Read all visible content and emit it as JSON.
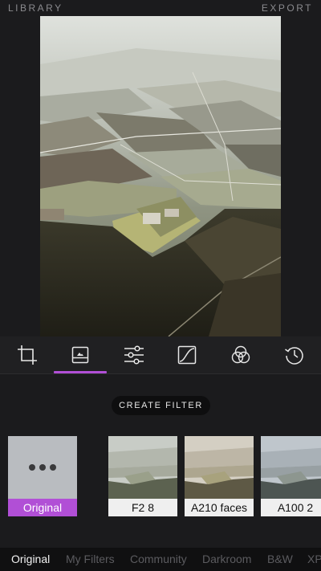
{
  "header": {
    "left": "LIBRARY",
    "right": "EXPORT"
  },
  "tools": [
    {
      "icon": "crop-icon"
    },
    {
      "icon": "filter-image-icon",
      "active": true
    },
    {
      "icon": "adjust-sliders-icon"
    },
    {
      "icon": "tone-curve-icon"
    },
    {
      "icon": "color-circles-icon"
    },
    {
      "icon": "history-icon"
    }
  ],
  "create_filter": "CREATE FILTER",
  "filters": [
    {
      "name": "Original",
      "selected": true
    },
    {
      "name": "F2 8"
    },
    {
      "name": "A210 faces"
    },
    {
      "name": "A100 2"
    }
  ],
  "tabs": [
    {
      "label": "Original",
      "active": true
    },
    {
      "label": "My Filters"
    },
    {
      "label": "Community"
    },
    {
      "label": "Darkroom"
    },
    {
      "label": "B&W"
    },
    {
      "label": "XP"
    }
  ],
  "colors": {
    "accent": "#b14fd6",
    "background": "#1b1b1d"
  }
}
